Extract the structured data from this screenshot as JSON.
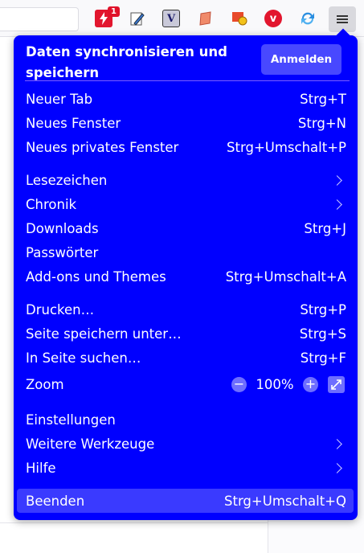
{
  "toolbar": {
    "extensions": [
      {
        "icon": "bolt-extension-icon",
        "badge": "1"
      },
      {
        "icon": "pen-extension-icon"
      },
      {
        "icon": "v-extension-icon",
        "text": "V"
      },
      {
        "icon": "scroll-extension-icon"
      },
      {
        "icon": "shield-extension-icon"
      },
      {
        "icon": "vivaldi-extension-icon",
        "text": "v"
      },
      {
        "icon": "sync-extension-icon"
      }
    ]
  },
  "panel": {
    "sync_title": "Daten synchronisieren und speichern",
    "signin_label": "Anmelden",
    "items": {
      "new_tab": {
        "label": "Neuer Tab",
        "shortcut": "Strg+T"
      },
      "new_window": {
        "label": "Neues Fenster",
        "shortcut": "Strg+N"
      },
      "private_window": {
        "label": "Neues privates Fenster",
        "shortcut": "Strg+Umschalt+P"
      },
      "bookmarks": {
        "label": "Lesezeichen"
      },
      "history": {
        "label": "Chronik"
      },
      "downloads": {
        "label": "Downloads",
        "shortcut": "Strg+J"
      },
      "passwords": {
        "label": "Passwörter"
      },
      "addons": {
        "label": "Add-ons und Themes",
        "shortcut": "Strg+Umschalt+A"
      },
      "print": {
        "label": "Drucken…",
        "shortcut": "Strg+P"
      },
      "save_page": {
        "label": "Seite speichern unter…",
        "shortcut": "Strg+S"
      },
      "find": {
        "label": "In Seite suchen…",
        "shortcut": "Strg+F"
      },
      "zoom": {
        "label": "Zoom",
        "value": "100%",
        "minus": "−",
        "plus": "+"
      },
      "settings": {
        "label": "Einstellungen"
      },
      "more_tools": {
        "label": "Weitere Werkzeuge"
      },
      "help": {
        "label": "Hilfe"
      },
      "quit": {
        "label": "Beenden",
        "shortcut": "Strg+Umschalt+Q"
      }
    }
  },
  "colors": {
    "panel_bg": "#0000ff",
    "highlight": "#3a3aff",
    "separator": "#7a5dff"
  }
}
